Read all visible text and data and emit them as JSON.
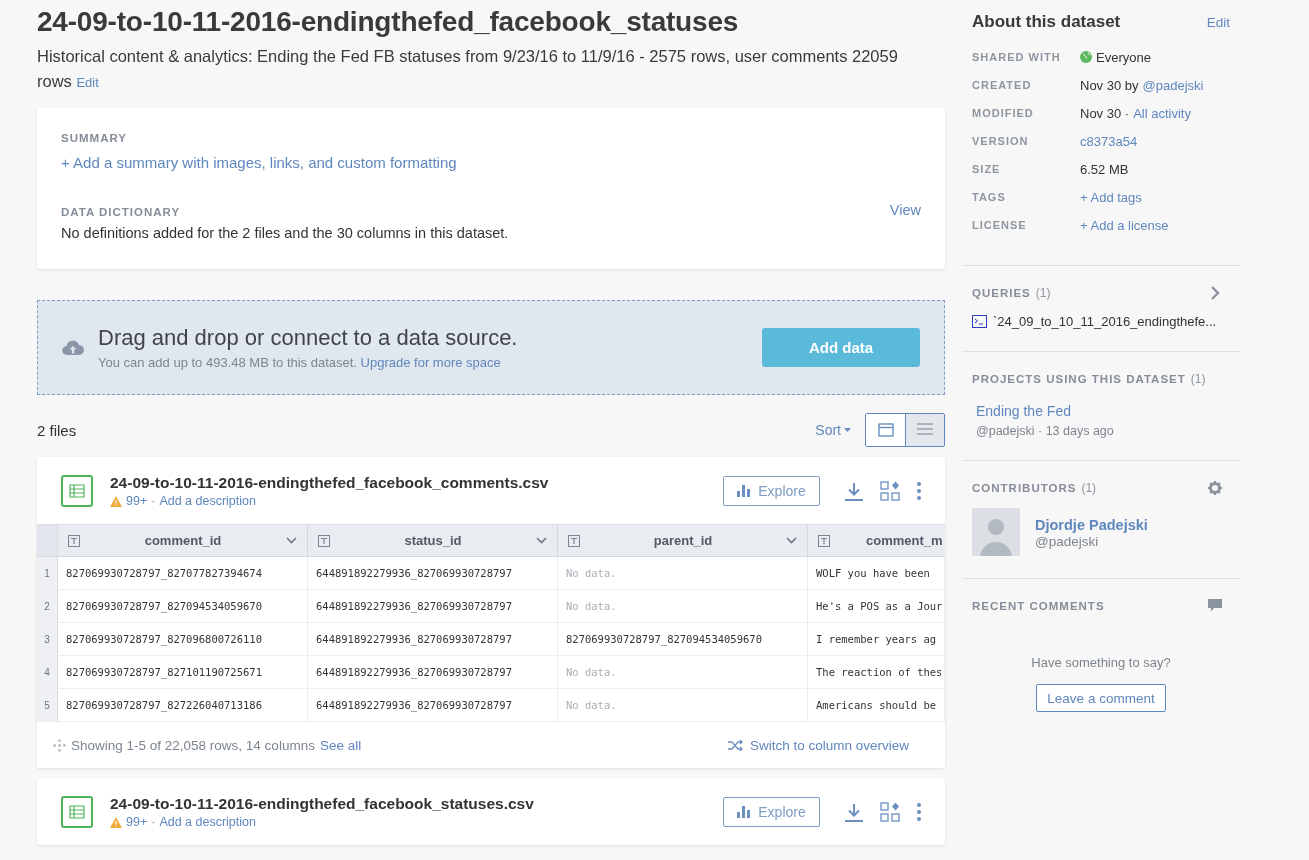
{
  "title": "24-09-to-10-11-2016-endingthefed_facebook_statuses",
  "description": "Historical content & analytics: Ending the Fed FB statuses from 9/23/16 to 11/9/16 - 2575 rows, user comments 22059 rows",
  "description_edit": "Edit",
  "summary": {
    "heading": "SUMMARY",
    "add_link": "+ Add a summary with images, links, and custom formatting",
    "dictionary_heading": "DATA DICTIONARY",
    "dictionary_link": "View",
    "dictionary_text": "No definitions added for the 2 files and the 30 columns in this dataset."
  },
  "dropzone": {
    "heading": "Drag and drop or connect to a data source.",
    "note": "You can add up to 493.48 MB to this dataset.",
    "upgrade_link": "Upgrade for more space",
    "button": "Add data"
  },
  "files_bar": {
    "count": "2 files",
    "sort": "Sort",
    "views": [
      {
        "kind": "card",
        "selected": false
      },
      {
        "kind": "list",
        "selected": true
      }
    ]
  },
  "files": [
    {
      "name": "24-09-to-10-11-2016-endingthefed_facebook_comments.csv",
      "warnings": "99+",
      "sep": "·",
      "add_description": "Add a description",
      "explore": "Explore",
      "table": {
        "columns": [
          "comment_id",
          "status_id",
          "parent_id",
          "comment_m"
        ],
        "rows": [
          {
            "number": "1",
            "cells": [
              {
                "text": "827069930728797_827077827394674",
                "empty": false
              },
              {
                "text": "644891892279936_827069930728797",
                "empty": false
              },
              {
                "text": "No data.",
                "empty": true
              },
              {
                "text": "WOLF you have been",
                "empty": false
              }
            ]
          },
          {
            "number": "2",
            "cells": [
              {
                "text": "827069930728797_827094534059670",
                "empty": false
              },
              {
                "text": "644891892279936_827069930728797",
                "empty": false
              },
              {
                "text": "No data.",
                "empty": true
              },
              {
                "text": "He's a POS as a Jour",
                "empty": false
              }
            ]
          },
          {
            "number": "3",
            "cells": [
              {
                "text": "827069930728797_827096800726110",
                "empty": false
              },
              {
                "text": "644891892279936_827069930728797",
                "empty": false
              },
              {
                "text": "827069930728797_827094534059670",
                "empty": false
              },
              {
                "text": "I remember years ag",
                "empty": false
              }
            ]
          },
          {
            "number": "4",
            "cells": [
              {
                "text": "827069930728797_827101190725671",
                "empty": false
              },
              {
                "text": "644891892279936_827069930728797",
                "empty": false
              },
              {
                "text": "No data.",
                "empty": true
              },
              {
                "text": "The reaction of thes",
                "empty": false
              }
            ]
          },
          {
            "number": "5",
            "cells": [
              {
                "text": "827069930728797_827226040713186",
                "empty": false
              },
              {
                "text": "644891892279936_827069930728797",
                "empty": false
              },
              {
                "text": "No data.",
                "empty": true
              },
              {
                "text": "Americans should be",
                "empty": false
              }
            ]
          }
        ],
        "footer": "Showing 1-5 of 22,058 rows, 14 columns",
        "see_all": "See all",
        "switch": "Switch to column overview"
      }
    },
    {
      "name": "24-09-to-10-11-2016-endingthefed_facebook_statuses.csv",
      "warnings": "99+",
      "sep": "·",
      "add_description": "Add a description",
      "explore": "Explore"
    }
  ],
  "sidebar": {
    "heading": "About this dataset",
    "edit": "Edit",
    "meta": [
      {
        "label": "SHARED WITH",
        "parts": [
          {
            "kind": "globe",
            "text": "Everyone"
          }
        ]
      },
      {
        "label": "CREATED",
        "parts": [
          {
            "kind": "text",
            "text": "Nov 30 by"
          },
          {
            "kind": "link",
            "text": "@padejski"
          }
        ]
      },
      {
        "label": "MODIFIED",
        "parts": [
          {
            "kind": "text",
            "text": "Nov 30 ·"
          },
          {
            "kind": "link",
            "text": "All activity"
          }
        ]
      },
      {
        "label": "VERSION",
        "parts": [
          {
            "kind": "link",
            "text": "c8373a54"
          }
        ]
      },
      {
        "label": "SIZE",
        "parts": [
          {
            "kind": "text",
            "text": "6.52 MB"
          }
        ]
      },
      {
        "label": "TAGS",
        "parts": [
          {
            "kind": "link",
            "text": "+ Add tags"
          }
        ]
      },
      {
        "label": "LICENSE",
        "parts": [
          {
            "kind": "link",
            "text": "+ Add a license"
          }
        ]
      }
    ],
    "queries": {
      "heading": "QUERIES",
      "count": "(1)",
      "items": [
        "`24_09_to_10_11_2016_endingthefe..."
      ]
    },
    "projects": {
      "heading": "PROJECTS USING THIS DATASET",
      "count": "(1)",
      "items": [
        {
          "name": "Ending the Fed",
          "meta": "@padejski · 13 days ago"
        }
      ]
    },
    "contributors": {
      "heading": "CONTRIBUTORS",
      "count": "(1)",
      "items": [
        {
          "name": "Djordje Padejski",
          "handle": "@padejski"
        }
      ]
    },
    "comments": {
      "heading": "RECENT COMMENTS",
      "prompt": "Have something to say?",
      "button": "Leave a comment"
    }
  }
}
